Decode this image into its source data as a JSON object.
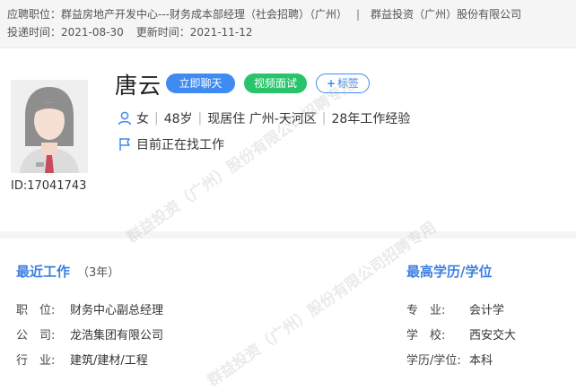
{
  "header": {
    "applied_label": "应聘职位：",
    "applied_position": "群益房地产开发中心---财务成本部经理（社会招聘）（广州）",
    "separator": "|",
    "company": "群益投资（广州）股份有限公司",
    "submitted_label": "投递时间：",
    "submitted_date": "2021-08-30",
    "updated_label": "更新时间：",
    "updated_date": "2021-11-12"
  },
  "candidate": {
    "id_text": "ID:17041743",
    "name": "唐云",
    "gender": "女",
    "age": "48岁",
    "residence": "现居住 广州-天河区",
    "experience": "28年工作经验",
    "job_status": "目前正在找工作"
  },
  "actions": {
    "chat": "立即聊天",
    "video": "视频面试",
    "tag": "标签"
  },
  "work": {
    "title": "最近工作",
    "years": "（3年）",
    "rows": [
      {
        "label": "职　位:",
        "value": "财务中心副总经理"
      },
      {
        "label": "公　司:",
        "value": "龙浩集团有限公司"
      },
      {
        "label": "行　业:",
        "value": "建筑/建材/工程"
      }
    ]
  },
  "education": {
    "title": "最高学历/学位",
    "rows": [
      {
        "label": "专　业:",
        "value": "会计学"
      },
      {
        "label": "学　校:",
        "value": "西安交大"
      },
      {
        "label": "学历/学位:",
        "value": "本科"
      }
    ]
  },
  "watermark": {
    "text": "群益投资（广州）股份有限公司招聘专用"
  },
  "colors": {
    "accent_blue": "#3f8bf2",
    "accent_green": "#28c46b",
    "section_title": "#3f7fe0"
  }
}
